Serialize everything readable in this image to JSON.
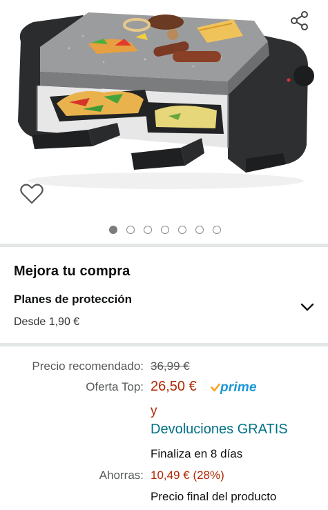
{
  "gallery": {
    "image_alt": "Raclette grill",
    "dots_total": 7,
    "active_dot": 0,
    "share_icon": "share-icon",
    "wishlist_icon": "heart-icon"
  },
  "upgrade": {
    "title": "Mejora tu compra",
    "plan_title": "Planes de protección",
    "plan_from": "Desde 1,90 €",
    "chevron_icon": "chevron-down-icon"
  },
  "pricing": {
    "list_label": "Precio recomendado:",
    "list_price": "36,99 €",
    "deal_label": "Oferta Top:",
    "deal_price": "26,50 €",
    "prime_label": "prime",
    "and_text": "y",
    "returns_text": "Devoluciones GRATIS",
    "ends_text": "Finaliza en 8 días",
    "savings_label": "Ahorras:",
    "savings_value": "10,49 € (28%)",
    "final_text": "Precio final del producto"
  },
  "colors": {
    "price_red": "#b12704",
    "link_teal": "#007185",
    "prime_blue": "#1a98d5",
    "prime_check": "#f7a21b",
    "divider": "#e3e6e6"
  }
}
